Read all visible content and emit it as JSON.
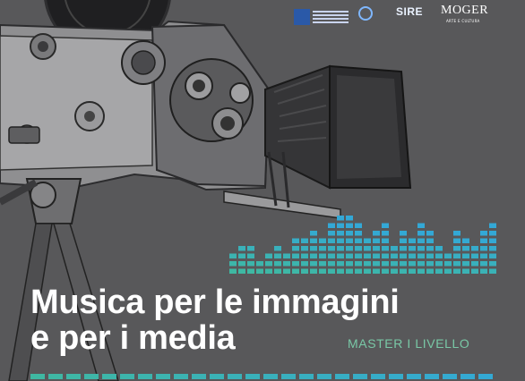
{
  "poster": {
    "title_line1": "Musica per le immagini",
    "title_line2": "e per i media",
    "subtitle": "MASTER I LIVELLO"
  },
  "logos": {
    "mibact": {
      "name": "MiBACT",
      "icon": "mibact-logo"
    },
    "quantum": {
      "icon": "quantum-logo"
    },
    "sire": {
      "name": "SIRE"
    },
    "moger": {
      "name": "MOGER",
      "tagline": "ARTE E CULTURA"
    }
  },
  "equalizer": {
    "levels": [
      3,
      4,
      4,
      2,
      3,
      4,
      3,
      5,
      5,
      6,
      5,
      7,
      8,
      8,
      7,
      5,
      6,
      7,
      4,
      6,
      5,
      7,
      6,
      4,
      3,
      6,
      5,
      4,
      6,
      7
    ]
  },
  "colors": {
    "background": "#58585a",
    "title": "#ffffff",
    "subtitle": "#79c8a6",
    "equalizer_from": "#3fb8a2",
    "equalizer_to": "#33a8d6"
  }
}
